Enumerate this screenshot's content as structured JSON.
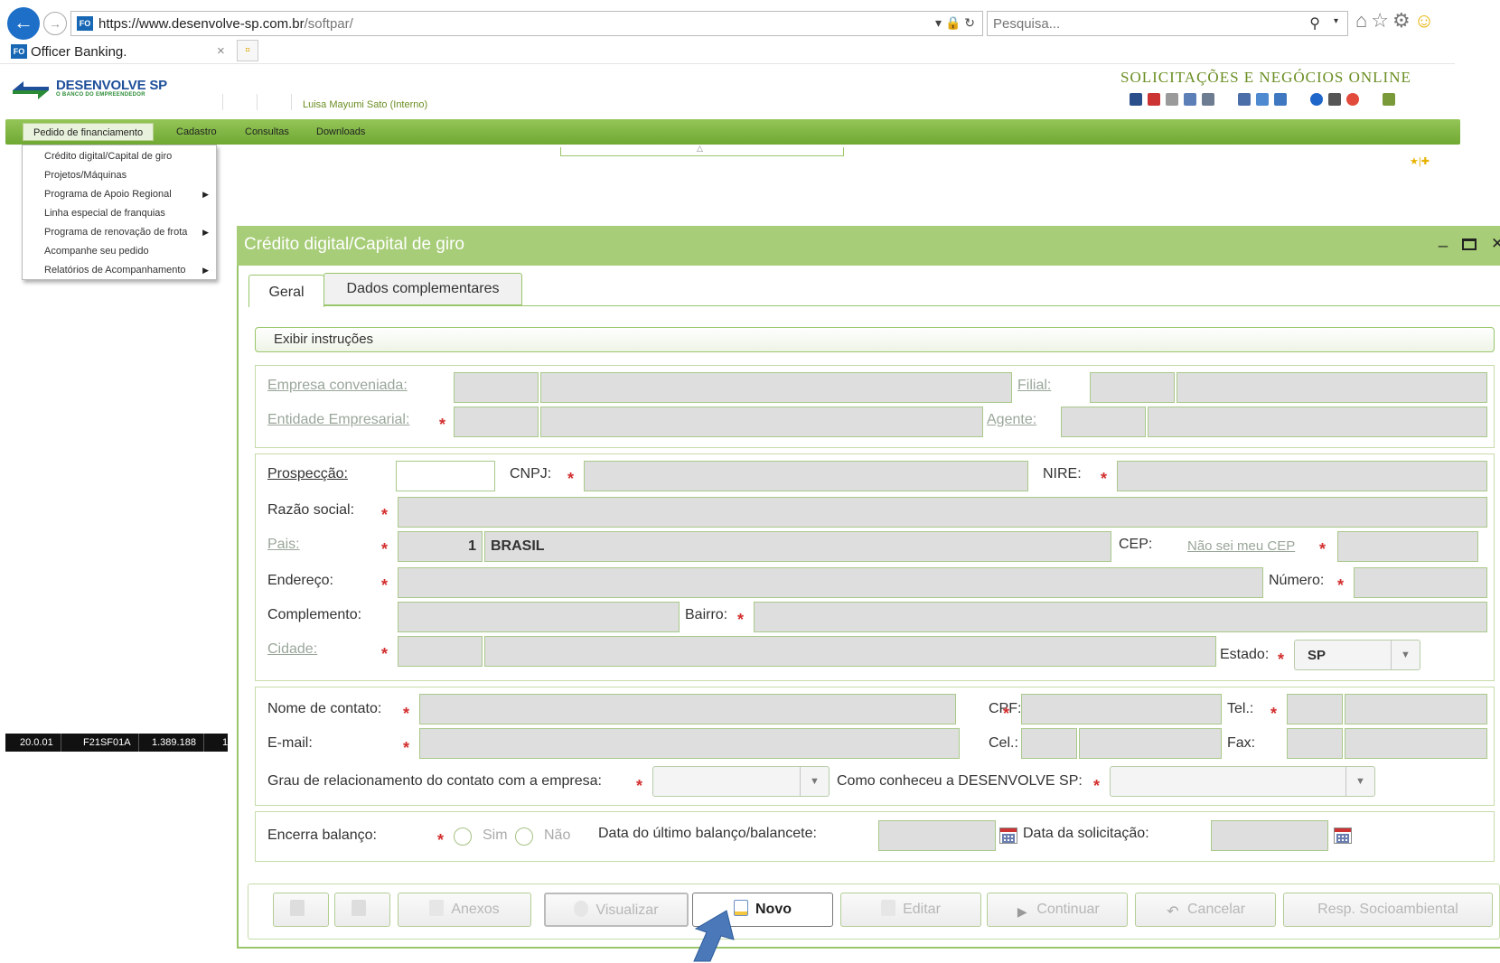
{
  "browser": {
    "url_domain": "https://www.desenvolve-sp.com.br",
    "url_path": "/softpar/",
    "search_placeholder": "Pesquisa...",
    "tab_title": "Officer Banking.",
    "favicon_text": "FO"
  },
  "header": {
    "logo_text": "DESENVOLVE SP",
    "logo_sub": "O BANCO DO EMPREENDEDOR",
    "user": "Luisa Mayumi Sato (Interno)",
    "site_title": "SOLICITAÇÕES E NEGÓCIOS ONLINE"
  },
  "nav": {
    "items": [
      "Pedido de financiamento",
      "Cadastro",
      "Consultas",
      "Downloads"
    ]
  },
  "menu": {
    "items": [
      {
        "label": "Crédito digital/Capital de giro",
        "sub": false
      },
      {
        "label": "Projetos/Máquinas",
        "sub": false
      },
      {
        "label": "Programa de Apoio Regional",
        "sub": true
      },
      {
        "label": "Linha especial de franquias",
        "sub": false
      },
      {
        "label": "Programa de renovação de frota",
        "sub": true
      },
      {
        "label": "Acompanhe seu pedido",
        "sub": false
      },
      {
        "label": "Relatórios de Acompanhamento",
        "sub": true
      }
    ]
  },
  "status": {
    "items": [
      "20.0.01",
      "F21SF01A",
      "1.389.188",
      "1"
    ]
  },
  "dialog": {
    "title": "Crédito digital/Capital de giro",
    "tabs": [
      "Geral",
      "Dados complementares"
    ],
    "instructions_label": "Exibir instruções"
  },
  "form": {
    "empresa_conveniada": "Empresa conveniada:",
    "filial": "Filial:",
    "entidade_empresarial": "Entidade Empresarial:",
    "agente": "Agente:",
    "prospeccao": "Prospecção:",
    "cnpj": "CNPJ:",
    "nire": "NIRE:",
    "razao_social": "Razão social:",
    "pais": "Pais:",
    "pais_code": "1",
    "pais_name": "BRASIL",
    "cep": "CEP:",
    "nao_sei_cep": "Não sei meu CEP",
    "endereco": "Endereço:",
    "numero": "Número:",
    "complemento": "Complemento:",
    "bairro": "Bairro:",
    "cidade": "Cidade:",
    "estado": "Estado:",
    "estado_value": "SP",
    "nome_contato": "Nome de contato:",
    "cpf": "CPF:",
    "tel": "Tel.:",
    "email": "E-mail:",
    "cel": "Cel.:",
    "fax": "Fax:",
    "grau": "Grau de relacionamento do contato com a empresa:",
    "como_conheceu": "Como conheceu a DESENVOLVE SP:",
    "encerra_balanco": "Encerra balanço:",
    "sim": "Sim",
    "nao": "Não",
    "data_ultimo_balanco": "Data do último balanço/balancete:",
    "data_solicitacao": "Data da solicitação:",
    "required_mark": "*"
  },
  "buttons": {
    "anexos": "Anexos",
    "visualizar": "Visualizar",
    "novo": "Novo",
    "editar": "Editar",
    "continuar": "Continuar",
    "cancelar": "Cancelar",
    "resp_socioambiental": "Resp. Socioambiental"
  },
  "colors": {
    "accent_green": "#a7cd78",
    "nav_green": "#6fa932",
    "required_red": "#d32f2f",
    "pointer_blue": "#4a78b8"
  }
}
